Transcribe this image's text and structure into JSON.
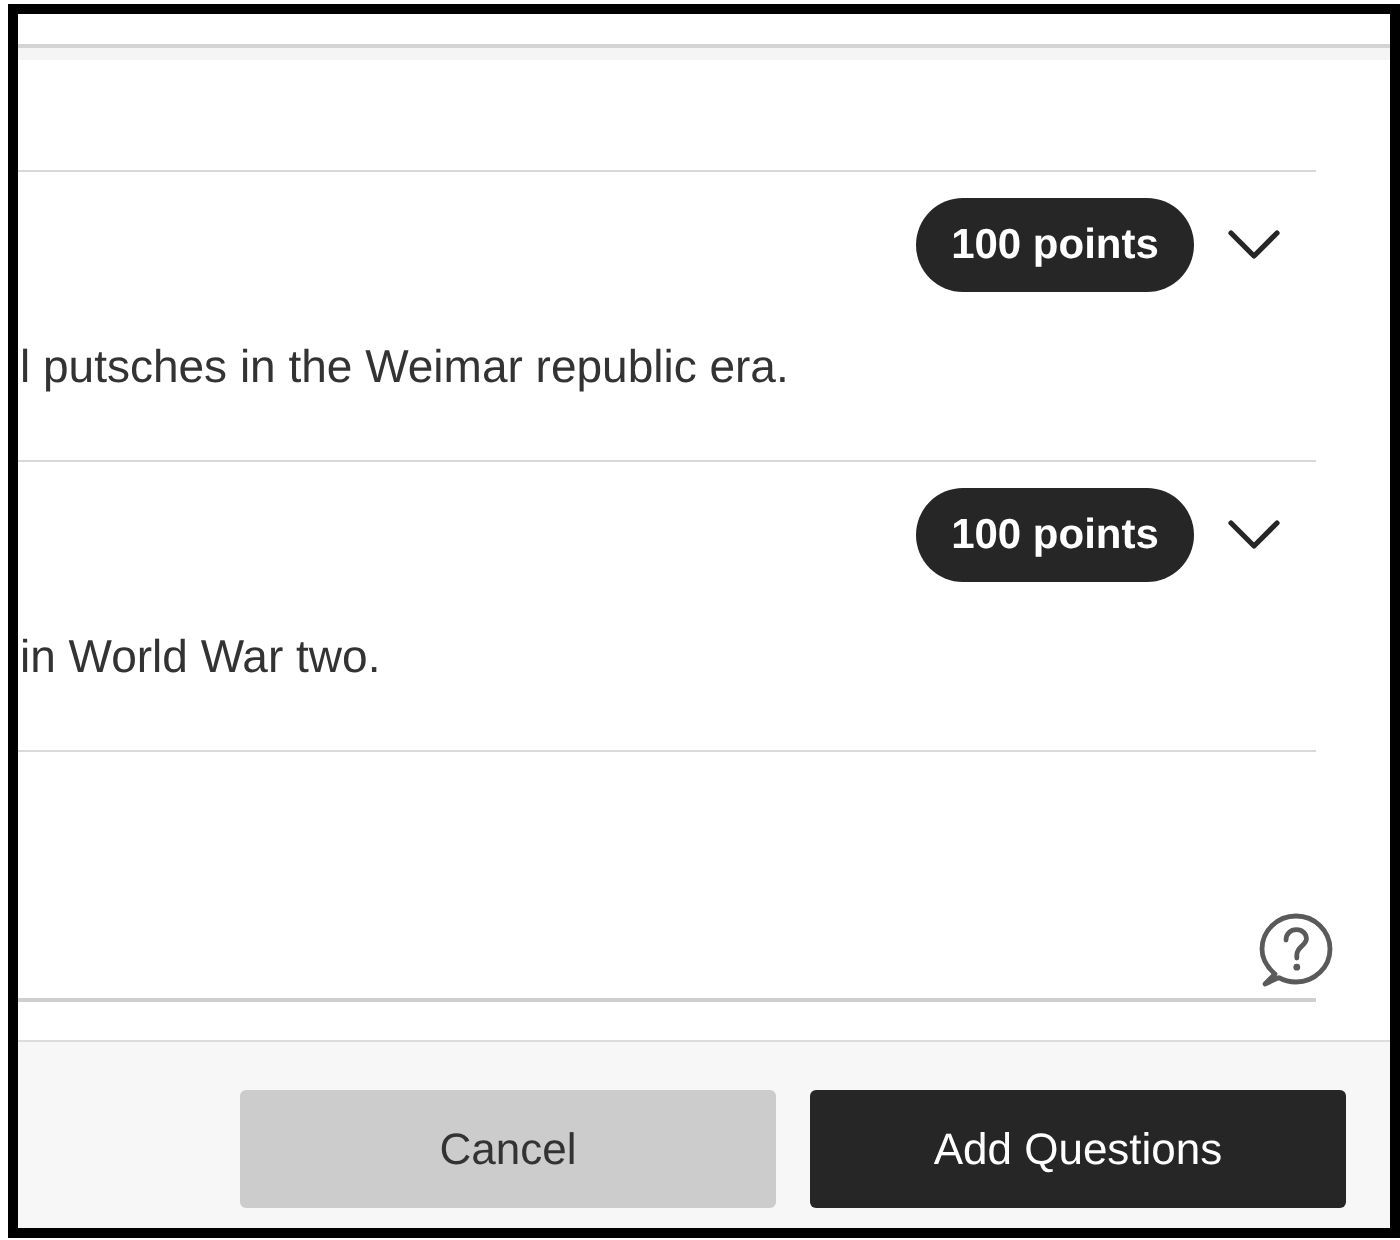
{
  "questions": [
    {
      "points": "100 points",
      "expanded": false,
      "text": "l putsches in the Weimar republic era."
    },
    {
      "points": "100 points",
      "expanded": false,
      "text": "in World War two."
    }
  ],
  "footer": {
    "buttons": [
      {
        "label": "Cancel",
        "kind": "secondary"
      },
      {
        "label": "Add Questions",
        "kind": "primary"
      }
    ]
  }
}
